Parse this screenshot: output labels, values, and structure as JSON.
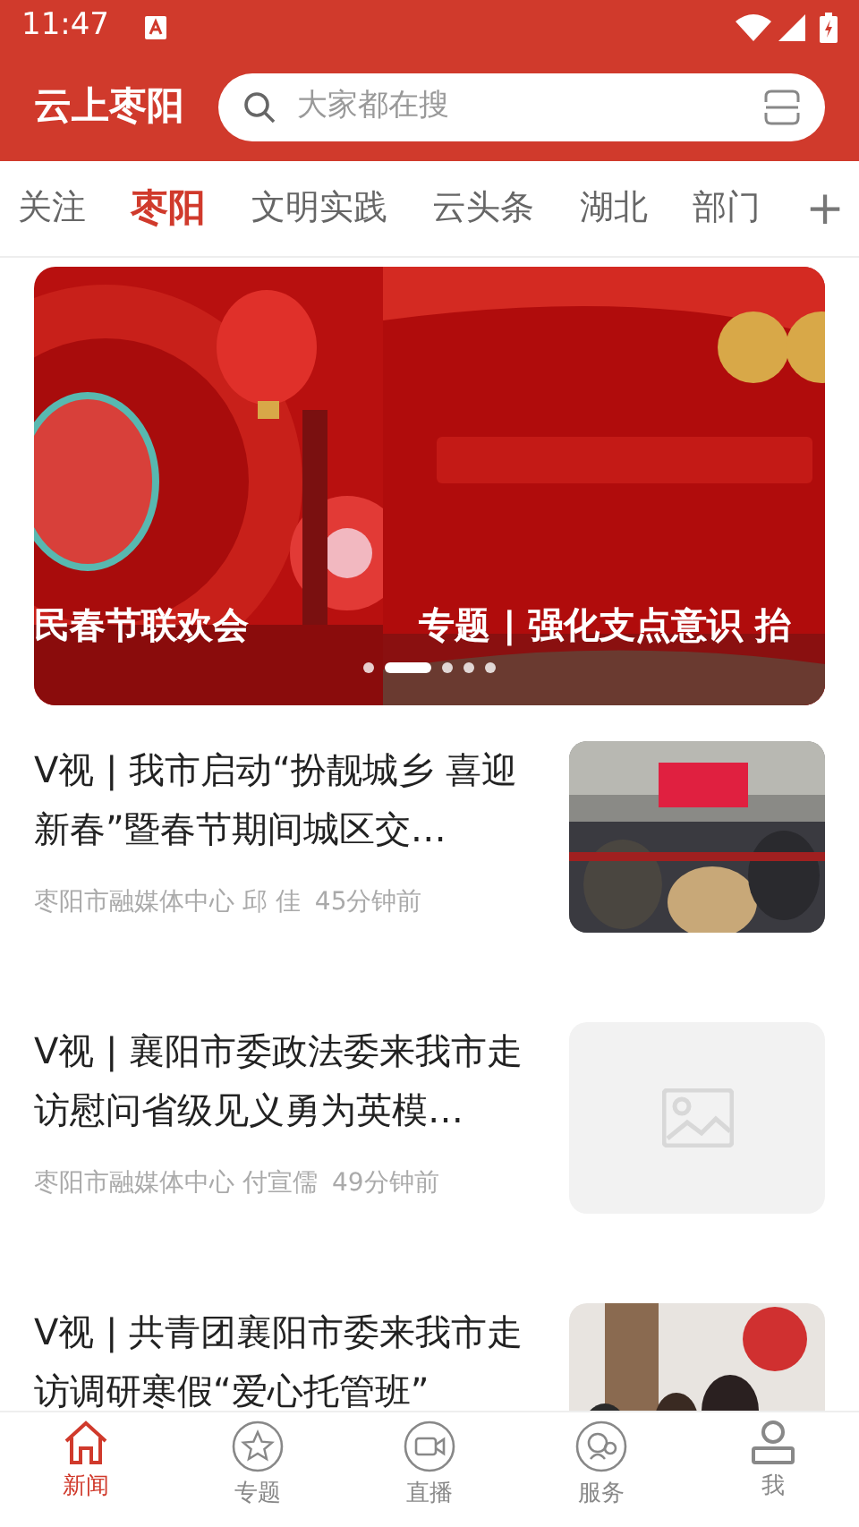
{
  "status_bar": {
    "time": "11:47"
  },
  "header": {
    "logo": "云上枣阳",
    "search": {
      "placeholder": "大家都在搜"
    }
  },
  "tabs": [
    {
      "label": "关注",
      "selected": false
    },
    {
      "label": "枣阳",
      "selected": true
    },
    {
      "label": "文明实践",
      "selected": false
    },
    {
      "label": "云头条",
      "selected": false
    },
    {
      "label": "湖北",
      "selected": false
    },
    {
      "label": "部门",
      "selected": false
    }
  ],
  "add_tab": "+",
  "banner": {
    "slides": [
      {
        "caption": "民春节联欢会",
        "kind": "picture"
      },
      {
        "caption": "专题 | 强化支点意识 抬",
        "kind": "picture"
      }
    ],
    "indicators": [
      {
        "selected": false
      },
      {
        "selected": true
      },
      {
        "selected": false
      },
      {
        "selected": false
      },
      {
        "selected": false
      }
    ]
  },
  "news": [
    {
      "title": "V视 | 我市启动“扮靓城乡  喜迎新春”暨春节期间城区交…",
      "source": "枣阳市融媒体中心 邱 佳",
      "time": "45分钟前",
      "kind": "picture"
    },
    {
      "title": "V视 | 襄阳市委政法委来我市走访慰问省级见义勇为英模…",
      "source": "枣阳市融媒体中心 付宣儒",
      "time": "49分钟前",
      "kind": "placeholder"
    },
    {
      "title": "V视 | 共青团襄阳市委来我市走访调研寒假“爱心托管班”",
      "kind": "picture"
    }
  ],
  "bottom_nav": [
    {
      "label": "新闻",
      "selected": true
    },
    {
      "label": "专题",
      "selected": false
    },
    {
      "label": "直播",
      "selected": false
    },
    {
      "label": "服务",
      "selected": false
    },
    {
      "label": "我",
      "selected": false
    }
  ]
}
